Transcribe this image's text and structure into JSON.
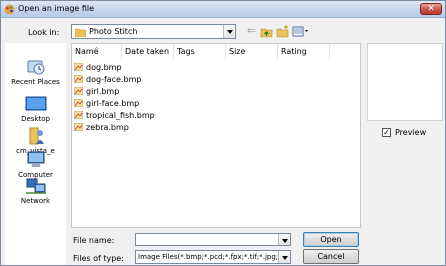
{
  "window": {
    "title": "Open an image file",
    "close_glyph": "✕"
  },
  "lookin": {
    "label": "Look in:",
    "value": "Photo Stitch"
  },
  "toolbar": {
    "back_glyph": "⇐"
  },
  "places": [
    {
      "label": "Recent Places",
      "icon": "recent-places-icon"
    },
    {
      "label": "Desktop",
      "icon": "desktop-icon"
    },
    {
      "label": "cm_vista_e",
      "icon": "user-folder-icon"
    },
    {
      "label": "Computer",
      "icon": "computer-icon"
    },
    {
      "label": "Network",
      "icon": "network-icon"
    }
  ],
  "columns": {
    "name": "Name",
    "date_taken": "Date taken",
    "tags": "Tags",
    "size": "Size",
    "rating": "Rating",
    "sort_glyph": "^"
  },
  "files": [
    {
      "name": "dog.bmp"
    },
    {
      "name": "dog-face.bmp"
    },
    {
      "name": "girl.bmp"
    },
    {
      "name": "girl-face.bmp"
    },
    {
      "name": "tropical_fish.bmp"
    },
    {
      "name": "zebra.bmp"
    }
  ],
  "preview": {
    "label": "Preview",
    "checked": true,
    "check_glyph": "✓"
  },
  "filename": {
    "label": "File name:",
    "value": ""
  },
  "filetype": {
    "label": "Files of type:",
    "value": "Image Files(*.bmp;*.pcd;*.fpx;*.tif;*.jpg;*.pcx;*.w"
  },
  "buttons": {
    "open": "Open",
    "cancel": "Cancel"
  }
}
